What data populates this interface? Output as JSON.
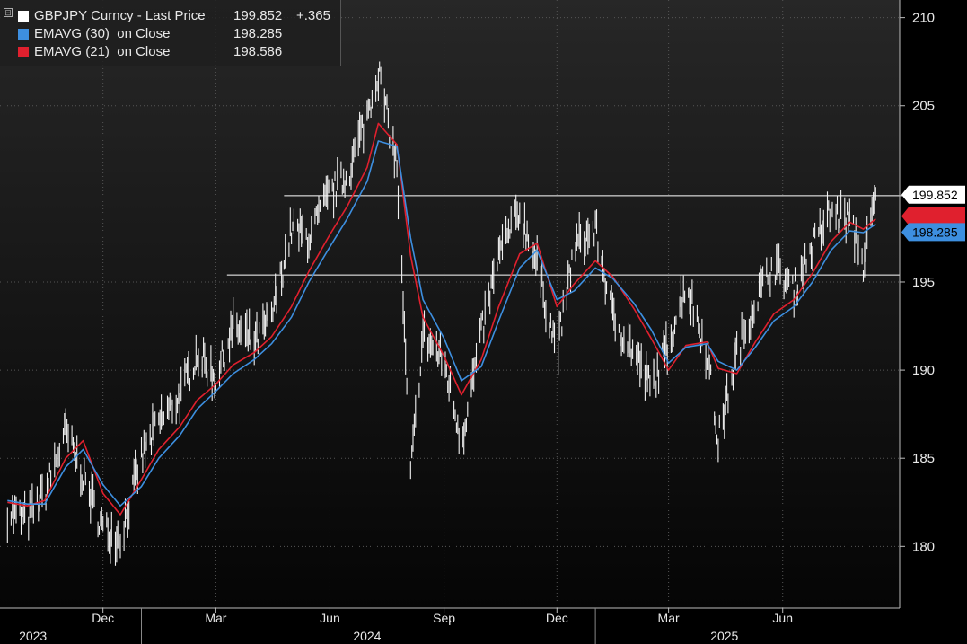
{
  "legend": {
    "rows": [
      {
        "name": "GBPJPY Curncy - Last Price",
        "value": "199.852",
        "change": "+.365",
        "color": "#ffffff"
      },
      {
        "name": "EMAVG (30)  on Close",
        "value": "198.285",
        "change": "",
        "color": "#3d8fe0"
      },
      {
        "name": "EMAVG (21)  on Close",
        "value": "198.586",
        "change": "",
        "color": "#e0202e"
      }
    ]
  },
  "chart_data": {
    "type": "line",
    "ylim": [
      176.5,
      211
    ],
    "y_ticks": [
      210,
      205,
      195,
      190,
      185,
      180
    ],
    "month_ticks": [
      "Dec",
      "Mar",
      "Jun",
      "Sep",
      "Dec",
      "Mar",
      "Jun"
    ],
    "year_labels": [
      "2023",
      "2024",
      "2025"
    ],
    "price_tag": {
      "value": "199.852",
      "color": "#ffffff"
    },
    "ema_tags": [
      {
        "value": "198.285",
        "color": "#3d8fe0"
      },
      {
        "value": "198.586",
        "color": "#e0202e"
      }
    ],
    "horizontal_lines": [
      199.9,
      195.4
    ],
    "series": [
      {
        "name": "GBPJPY Curncy - Last Price",
        "color": "#ffffff",
        "x": [
          "2023-09-15",
          "2023-10-01",
          "2023-10-15",
          "2023-11-01",
          "2023-11-15",
          "2023-12-01",
          "2023-12-15",
          "2024-01-01",
          "2024-01-15",
          "2024-02-01",
          "2024-02-15",
          "2024-03-01",
          "2024-03-15",
          "2024-04-01",
          "2024-04-15",
          "2024-05-01",
          "2024-05-15",
          "2024-06-01",
          "2024-06-15",
          "2024-07-01",
          "2024-07-10",
          "2024-07-25",
          "2024-08-05",
          "2024-08-15",
          "2024-09-01",
          "2024-09-15",
          "2024-10-01",
          "2024-10-15",
          "2024-11-01",
          "2024-11-15",
          "2024-12-01",
          "2024-12-15",
          "2025-01-01",
          "2025-01-15",
          "2025-02-01",
          "2025-02-15",
          "2025-03-01",
          "2025-03-15",
          "2025-04-01",
          "2025-04-10",
          "2025-04-25",
          "2025-05-10",
          "2025-05-25",
          "2025-06-10",
          "2025-06-25",
          "2025-07-10",
          "2025-07-25",
          "2025-08-05",
          "2025-08-15"
        ],
        "values": [
          182.0,
          181.5,
          183.0,
          186.5,
          184.0,
          181.0,
          180.5,
          185.0,
          187.0,
          188.5,
          191.0,
          189.5,
          192.5,
          191.5,
          193.0,
          198.0,
          197.5,
          200.0,
          201.0,
          204.5,
          207.0,
          201.5,
          184.0,
          192.0,
          190.5,
          186.0,
          192.0,
          196.5,
          199.0,
          196.0,
          191.0,
          197.0,
          198.0,
          193.0,
          191.0,
          189.0,
          191.5,
          195.0,
          191.0,
          186.0,
          191.0,
          194.0,
          196.0,
          194.5,
          197.0,
          199.0,
          198.5,
          196.0,
          199.852
        ]
      },
      {
        "name": "EMAVG (30)  on Close",
        "color": "#3d8fe0",
        "x": [
          "2023-09-15",
          "2023-10-01",
          "2023-10-15",
          "2023-11-01",
          "2023-11-15",
          "2023-12-01",
          "2023-12-15",
          "2024-01-01",
          "2024-01-15",
          "2024-02-01",
          "2024-02-15",
          "2024-03-01",
          "2024-03-15",
          "2024-04-01",
          "2024-04-15",
          "2024-05-01",
          "2024-05-15",
          "2024-06-01",
          "2024-06-15",
          "2024-07-01",
          "2024-07-10",
          "2024-07-25",
          "2024-08-05",
          "2024-08-15",
          "2024-09-01",
          "2024-09-15",
          "2024-10-01",
          "2024-10-15",
          "2024-11-01",
          "2024-11-15",
          "2024-12-01",
          "2024-12-15",
          "2025-01-01",
          "2025-01-15",
          "2025-02-01",
          "2025-02-15",
          "2025-03-01",
          "2025-03-15",
          "2025-04-01",
          "2025-04-10",
          "2025-04-25",
          "2025-05-10",
          "2025-05-25",
          "2025-06-10",
          "2025-06-25",
          "2025-07-10",
          "2025-07-25",
          "2025-08-05",
          "2025-08-15"
        ],
        "values": [
          182.6,
          182.4,
          182.4,
          184.5,
          185.5,
          183.5,
          182.3,
          183.4,
          185.0,
          186.3,
          187.8,
          188.8,
          189.8,
          190.6,
          191.5,
          193.0,
          195.0,
          197.0,
          198.6,
          200.7,
          203.0,
          202.7,
          197.5,
          194.0,
          191.8,
          189.4,
          190.2,
          192.8,
          195.8,
          196.8,
          194.0,
          194.5,
          195.8,
          195.2,
          193.8,
          192.3,
          190.4,
          191.3,
          191.5,
          190.5,
          190.0,
          191.3,
          192.8,
          193.6,
          195.0,
          196.8,
          197.9,
          197.8,
          198.285
        ]
      },
      {
        "name": "EMAVG (21)  on Close",
        "color": "#e0202e",
        "x": [
          "2023-09-15",
          "2023-10-01",
          "2023-10-15",
          "2023-11-01",
          "2023-11-15",
          "2023-12-01",
          "2023-12-15",
          "2024-01-01",
          "2024-01-15",
          "2024-02-01",
          "2024-02-15",
          "2024-03-01",
          "2024-03-15",
          "2024-04-01",
          "2024-04-15",
          "2024-05-01",
          "2024-05-15",
          "2024-06-01",
          "2024-06-15",
          "2024-07-01",
          "2024-07-10",
          "2024-07-25",
          "2024-08-05",
          "2024-08-15",
          "2024-09-01",
          "2024-09-15",
          "2024-10-01",
          "2024-10-15",
          "2024-11-01",
          "2024-11-15",
          "2024-12-01",
          "2024-12-15",
          "2025-01-01",
          "2025-01-15",
          "2025-02-01",
          "2025-02-15",
          "2025-03-01",
          "2025-03-15",
          "2025-04-01",
          "2025-04-10",
          "2025-04-25",
          "2025-05-10",
          "2025-05-25",
          "2025-06-10",
          "2025-06-25",
          "2025-07-10",
          "2025-07-25",
          "2025-08-05",
          "2025-08-15"
        ],
        "values": [
          182.5,
          182.3,
          182.6,
          185.0,
          186.0,
          183.0,
          181.8,
          183.8,
          185.5,
          186.8,
          188.3,
          189.2,
          190.3,
          191.0,
          191.9,
          193.6,
          195.6,
          197.7,
          199.3,
          201.5,
          204.0,
          202.8,
          196.5,
          193.0,
          190.8,
          188.6,
          190.6,
          193.6,
          196.6,
          197.2,
          193.6,
          194.9,
          196.2,
          195.3,
          193.5,
          191.8,
          190.0,
          191.4,
          191.6,
          190.1,
          189.8,
          191.6,
          193.2,
          194.0,
          195.5,
          197.3,
          198.4,
          198.0,
          198.586
        ]
      }
    ]
  }
}
